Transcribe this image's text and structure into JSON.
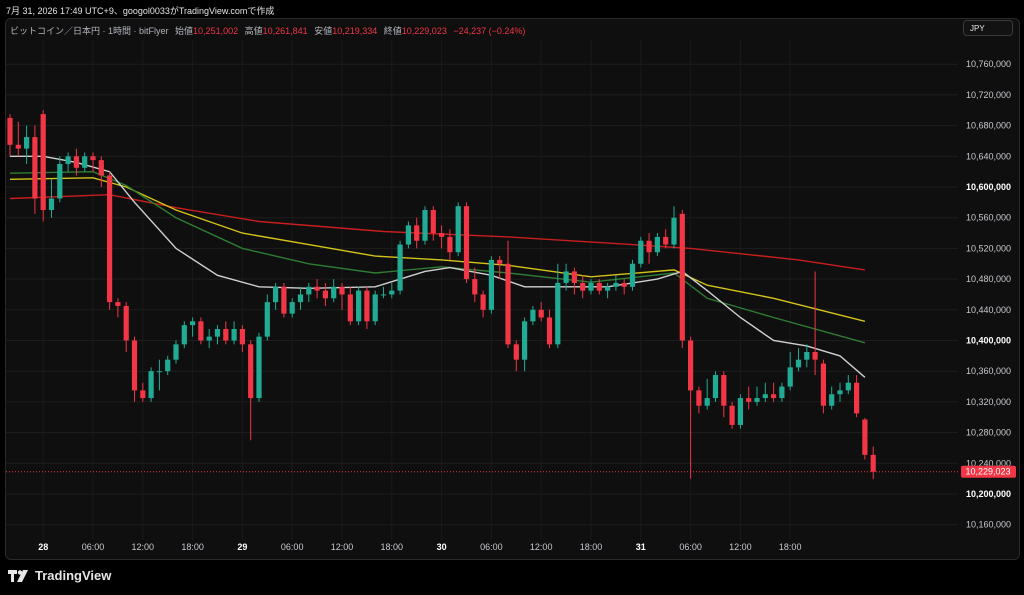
{
  "header": {
    "timestamp_line": "7月 31, 2026 17:49 UTC+9、googol0033がTradingView.comで作成"
  },
  "legend": {
    "symbol": "ビットコイン／日本円 · 1時間 · bitFlyer",
    "open_label": "始値",
    "open_value": "10,251,002",
    "high_label": "高値",
    "high_value": "10,261,841",
    "low_label": "安値",
    "low_value": "10,219,334",
    "close_label": "終値",
    "close_value": "10,229,023",
    "change": "−24,237 (−0.24%)"
  },
  "currency_button": "JPY",
  "brand": {
    "name": "TradingView"
  },
  "colors": {
    "up": "#22ab94",
    "down": "#f23645",
    "ma_red": "#c81e1e",
    "ma_yellow": "#d4c31a",
    "ma_green": "#2e7d32",
    "ma_white": "#d0d0d0",
    "price_label_bg": "#f23645"
  },
  "chart_data": {
    "type": "candlestick",
    "y_axis": {
      "range": [
        10140000,
        10780000
      ],
      "ticks": [
        {
          "value": 10760000,
          "label": "10,760,000"
        },
        {
          "value": 10720000,
          "label": "10,720,000"
        },
        {
          "value": 10680000,
          "label": "10,680,000"
        },
        {
          "value": 10640000,
          "label": "10,640,000"
        },
        {
          "value": 10600000,
          "label": "10,600,000",
          "bold": true
        },
        {
          "value": 10560000,
          "label": "10,560,000"
        },
        {
          "value": 10520000,
          "label": "10,520,000"
        },
        {
          "value": 10480000,
          "label": "10,480,000"
        },
        {
          "value": 10440000,
          "label": "10,440,000"
        },
        {
          "value": 10400000,
          "label": "10,400,000",
          "bold": true
        },
        {
          "value": 10360000,
          "label": "10,360,000"
        },
        {
          "value": 10320000,
          "label": "10,320,000"
        },
        {
          "value": 10280000,
          "label": "10,280,000"
        },
        {
          "value": 10240000,
          "label": "10,240,000"
        },
        {
          "value": 10200000,
          "label": "10,200,000",
          "bold": true
        },
        {
          "value": 10160000,
          "label": "10,160,000"
        }
      ]
    },
    "last_price": {
      "value": 10229023,
      "label": "10,229,023"
    },
    "x_axis": {
      "ticks": [
        {
          "index": 4,
          "label": "28",
          "bold": true
        },
        {
          "index": 10,
          "label": "06:00"
        },
        {
          "index": 16,
          "label": "12:00"
        },
        {
          "index": 22,
          "label": "18:00"
        },
        {
          "index": 28,
          "label": "29",
          "bold": true
        },
        {
          "index": 34,
          "label": "06:00"
        },
        {
          "index": 40,
          "label": "12:00"
        },
        {
          "index": 46,
          "label": "18:00"
        },
        {
          "index": 52,
          "label": "30",
          "bold": true
        },
        {
          "index": 58,
          "label": "06:00"
        },
        {
          "index": 64,
          "label": "12:00"
        },
        {
          "index": 70,
          "label": "18:00"
        },
        {
          "index": 76,
          "label": "31",
          "bold": true
        },
        {
          "index": 82,
          "label": "06:00"
        },
        {
          "index": 88,
          "label": "12:00"
        },
        {
          "index": 94,
          "label": "18:00"
        }
      ]
    },
    "candles": [
      [
        10690000,
        10655000,
        10695000,
        10640000
      ],
      [
        10655000,
        10650000,
        10685000,
        10640000
      ],
      [
        10650000,
        10665000,
        10680000,
        10630000
      ],
      [
        10665000,
        10585000,
        10680000,
        10565000
      ],
      [
        10695000,
        10570000,
        10700000,
        10555000
      ],
      [
        10570000,
        10585000,
        10610000,
        10560000
      ],
      [
        10585000,
        10630000,
        10640000,
        10580000
      ],
      [
        10630000,
        10640000,
        10645000,
        10620000
      ],
      [
        10640000,
        10625000,
        10650000,
        10615000
      ],
      [
        10625000,
        10640000,
        10645000,
        10620000
      ],
      [
        10640000,
        10635000,
        10645000,
        10620000
      ],
      [
        10635000,
        10615000,
        10640000,
        10600000
      ],
      [
        10615000,
        10450000,
        10620000,
        10440000
      ],
      [
        10450000,
        10445000,
        10455000,
        10430000
      ],
      [
        10445000,
        10400000,
        10450000,
        10385000
      ],
      [
        10400000,
        10335000,
        10405000,
        10320000
      ],
      [
        10335000,
        10325000,
        10345000,
        10320000
      ],
      [
        10325000,
        10360000,
        10365000,
        10320000
      ],
      [
        10360000,
        10360000,
        10375000,
        10335000
      ],
      [
        10360000,
        10375000,
        10380000,
        10355000
      ],
      [
        10375000,
        10395000,
        10400000,
        10370000
      ],
      [
        10395000,
        10420000,
        10425000,
        10390000
      ],
      [
        10420000,
        10425000,
        10430000,
        10405000
      ],
      [
        10425000,
        10400000,
        10430000,
        10395000
      ],
      [
        10400000,
        10405000,
        10415000,
        10390000
      ],
      [
        10405000,
        10415000,
        10420000,
        10395000
      ],
      [
        10415000,
        10400000,
        10425000,
        10395000
      ],
      [
        10400000,
        10415000,
        10425000,
        10395000
      ],
      [
        10415000,
        10395000,
        10420000,
        10385000
      ],
      [
        10395000,
        10325000,
        10400000,
        10270000
      ],
      [
        10325000,
        10405000,
        10410000,
        10320000
      ],
      [
        10405000,
        10450000,
        10460000,
        10400000
      ],
      [
        10450000,
        10470000,
        10475000,
        10440000
      ],
      [
        10470000,
        10435000,
        10475000,
        10430000
      ],
      [
        10435000,
        10450000,
        10455000,
        10430000
      ],
      [
        10450000,
        10460000,
        10470000,
        10440000
      ],
      [
        10460000,
        10470000,
        10475000,
        10450000
      ],
      [
        10470000,
        10465000,
        10480000,
        10455000
      ],
      [
        10465000,
        10455000,
        10475000,
        10445000
      ],
      [
        10455000,
        10470000,
        10480000,
        10450000
      ],
      [
        10470000,
        10460000,
        10475000,
        10440000
      ],
      [
        10460000,
        10425000,
        10470000,
        10420000
      ],
      [
        10425000,
        10465000,
        10470000,
        10420000
      ],
      [
        10465000,
        10425000,
        10470000,
        10415000
      ],
      [
        10425000,
        10460000,
        10465000,
        10420000
      ],
      [
        10460000,
        10460000,
        10470000,
        10455000
      ],
      [
        10460000,
        10465000,
        10475000,
        10455000
      ],
      [
        10465000,
        10525000,
        10530000,
        10460000
      ],
      [
        10525000,
        10550000,
        10555000,
        10520000
      ],
      [
        10550000,
        10530000,
        10560000,
        10520000
      ],
      [
        10530000,
        10570000,
        10575000,
        10525000
      ],
      [
        10570000,
        10540000,
        10575000,
        10530000
      ],
      [
        10540000,
        10535000,
        10550000,
        10520000
      ],
      [
        10535000,
        10515000,
        10545000,
        10505000
      ],
      [
        10515000,
        10575000,
        10580000,
        10510000
      ],
      [
        10575000,
        10480000,
        10580000,
        10475000
      ],
      [
        10480000,
        10460000,
        10495000,
        10450000
      ],
      [
        10460000,
        10440000,
        10465000,
        10430000
      ],
      [
        10440000,
        10505000,
        10510000,
        10435000
      ],
      [
        10505000,
        10500000,
        10510000,
        10480000
      ],
      [
        10500000,
        10395000,
        10530000,
        10390000
      ],
      [
        10395000,
        10375000,
        10400000,
        10360000
      ],
      [
        10375000,
        10425000,
        10430000,
        10360000
      ],
      [
        10425000,
        10440000,
        10445000,
        10420000
      ],
      [
        10440000,
        10430000,
        10450000,
        10425000
      ],
      [
        10430000,
        10395000,
        10440000,
        10390000
      ],
      [
        10395000,
        10475000,
        10500000,
        10390000
      ],
      [
        10475000,
        10490000,
        10500000,
        10465000
      ],
      [
        10490000,
        10475000,
        10495000,
        10460000
      ],
      [
        10475000,
        10465000,
        10485000,
        10455000
      ],
      [
        10465000,
        10475000,
        10480000,
        10460000
      ],
      [
        10475000,
        10465000,
        10480000,
        10460000
      ],
      [
        10465000,
        10470000,
        10475000,
        10455000
      ],
      [
        10470000,
        10475000,
        10485000,
        10465000
      ],
      [
        10475000,
        10470000,
        10480000,
        10460000
      ],
      [
        10470000,
        10500000,
        10505000,
        10465000
      ],
      [
        10500000,
        10530000,
        10535000,
        10495000
      ],
      [
        10530000,
        10515000,
        10540000,
        10500000
      ],
      [
        10515000,
        10535000,
        10540000,
        10510000
      ],
      [
        10535000,
        10525000,
        10545000,
        10520000
      ],
      [
        10525000,
        10560000,
        10575000,
        10520000
      ],
      [
        10565000,
        10400000,
        10570000,
        10390000
      ],
      [
        10400000,
        10335000,
        10405000,
        10220000
      ],
      [
        10335000,
        10315000,
        10340000,
        10305000
      ],
      [
        10315000,
        10325000,
        10350000,
        10310000
      ],
      [
        10325000,
        10355000,
        10360000,
        10320000
      ],
      [
        10355000,
        10315000,
        10360000,
        10300000
      ],
      [
        10315000,
        10290000,
        10320000,
        10285000
      ],
      [
        10290000,
        10325000,
        10330000,
        10285000
      ],
      [
        10325000,
        10320000,
        10340000,
        10310000
      ],
      [
        10320000,
        10325000,
        10340000,
        10315000
      ],
      [
        10325000,
        10330000,
        10345000,
        10320000
      ],
      [
        10330000,
        10325000,
        10345000,
        10320000
      ],
      [
        10325000,
        10340000,
        10345000,
        10320000
      ],
      [
        10340000,
        10365000,
        10385000,
        10335000
      ],
      [
        10365000,
        10375000,
        10390000,
        10360000
      ],
      [
        10375000,
        10385000,
        10395000,
        10365000
      ],
      [
        10385000,
        10375000,
        10490000,
        10355000
      ],
      [
        10370000,
        10315000,
        10375000,
        10305000
      ],
      [
        10315000,
        10330000,
        10340000,
        10310000
      ],
      [
        10330000,
        10335000,
        10345000,
        10320000
      ],
      [
        10335000,
        10345000,
        10355000,
        10330000
      ],
      [
        10345000,
        10305000,
        10355000,
        10300000
      ],
      [
        10297000,
        10251000,
        10299000,
        10245000
      ],
      [
        10251002,
        10229023,
        10261841,
        10219334
      ]
    ],
    "moving_averages": [
      {
        "color": "#c81e1e",
        "points": [
          [
            0,
            10585000
          ],
          [
            12,
            10590000
          ],
          [
            20,
            10573000
          ],
          [
            30,
            10555000
          ],
          [
            45,
            10542000
          ],
          [
            60,
            10535000
          ],
          [
            75,
            10525000
          ],
          [
            82,
            10520000
          ],
          [
            95,
            10505000
          ],
          [
            103,
            10492000
          ]
        ]
      },
      {
        "color": "#d4c31a",
        "points": [
          [
            0,
            10610000
          ],
          [
            10,
            10612000
          ],
          [
            14,
            10600000
          ],
          [
            20,
            10570000
          ],
          [
            28,
            10540000
          ],
          [
            36,
            10525000
          ],
          [
            44,
            10510000
          ],
          [
            52,
            10505000
          ],
          [
            60,
            10498000
          ],
          [
            70,
            10483000
          ],
          [
            80,
            10492000
          ],
          [
            84,
            10472000
          ],
          [
            92,
            10455000
          ],
          [
            103,
            10425000
          ]
        ]
      },
      {
        "color": "#2e7d32",
        "points": [
          [
            0,
            10618000
          ],
          [
            10,
            10620000
          ],
          [
            14,
            10602000
          ],
          [
            20,
            10560000
          ],
          [
            28,
            10520000
          ],
          [
            36,
            10500000
          ],
          [
            44,
            10488000
          ],
          [
            52,
            10496000
          ],
          [
            60,
            10488000
          ],
          [
            70,
            10476000
          ],
          [
            80,
            10488000
          ],
          [
            84,
            10455000
          ],
          [
            92,
            10430000
          ],
          [
            103,
            10397000
          ]
        ]
      },
      {
        "color": "#d0d0d0",
        "points": [
          [
            0,
            10640000
          ],
          [
            4,
            10640000
          ],
          [
            8,
            10632000
          ],
          [
            12,
            10620000
          ],
          [
            15,
            10580000
          ],
          [
            20,
            10520000
          ],
          [
            25,
            10485000
          ],
          [
            30,
            10470000
          ],
          [
            36,
            10468000
          ],
          [
            44,
            10470000
          ],
          [
            50,
            10490000
          ],
          [
            53,
            10495000
          ],
          [
            58,
            10485000
          ],
          [
            62,
            10470000
          ],
          [
            66,
            10470000
          ],
          [
            72,
            10470000
          ],
          [
            78,
            10480000
          ],
          [
            81,
            10490000
          ],
          [
            84,
            10465000
          ],
          [
            88,
            10430000
          ],
          [
            92,
            10400000
          ],
          [
            96,
            10393000
          ],
          [
            100,
            10380000
          ],
          [
            103,
            10352000
          ]
        ]
      }
    ]
  }
}
